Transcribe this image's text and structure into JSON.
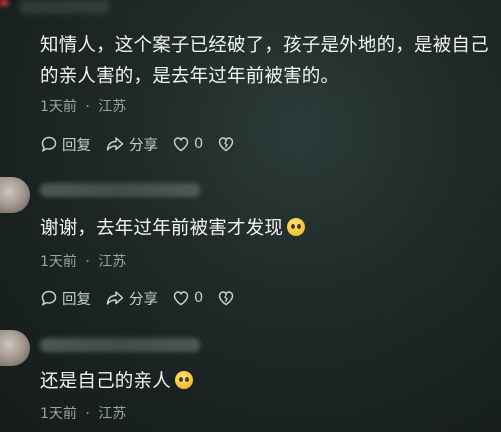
{
  "comments": [
    {
      "text": "知情人，这个案子已经破了，孩子是外地的，是被自己的亲人害的，是去年过年前被害的。",
      "line1": "知情人，这个案子已经破了，孩子是外地的，是被自己",
      "line2": "的亲人害的，是去年过年前被害的。",
      "time": "1天前",
      "location": "江苏",
      "reply_label": "回复",
      "share_label": "分享",
      "likes": "0"
    },
    {
      "text": "谢谢，去年过年前被害才发现",
      "time": "1天前",
      "location": "江苏",
      "reply_label": "回复",
      "share_label": "分享",
      "likes": "0"
    },
    {
      "text": "还是自己的亲人",
      "time": "1天前",
      "location": "江苏"
    }
  ],
  "meta_separator": "·",
  "icons": [
    "comment-icon",
    "share-icon",
    "heart-icon",
    "broken-heart-icon",
    "pleading-face-emoji"
  ]
}
